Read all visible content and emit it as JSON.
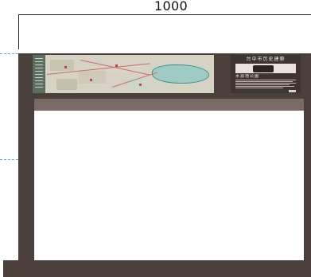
{
  "dimension": {
    "width_label": "1000"
  },
  "info_panel": {
    "title": "台中市历史建築",
    "caption": "水源地公園"
  },
  "colors": {
    "structure": "#4b3f3b",
    "header_inner": "#7a6a65",
    "guide": "#6aa8d4",
    "map_bg": "#d6d2c4",
    "lake": "#9fcbc4"
  }
}
